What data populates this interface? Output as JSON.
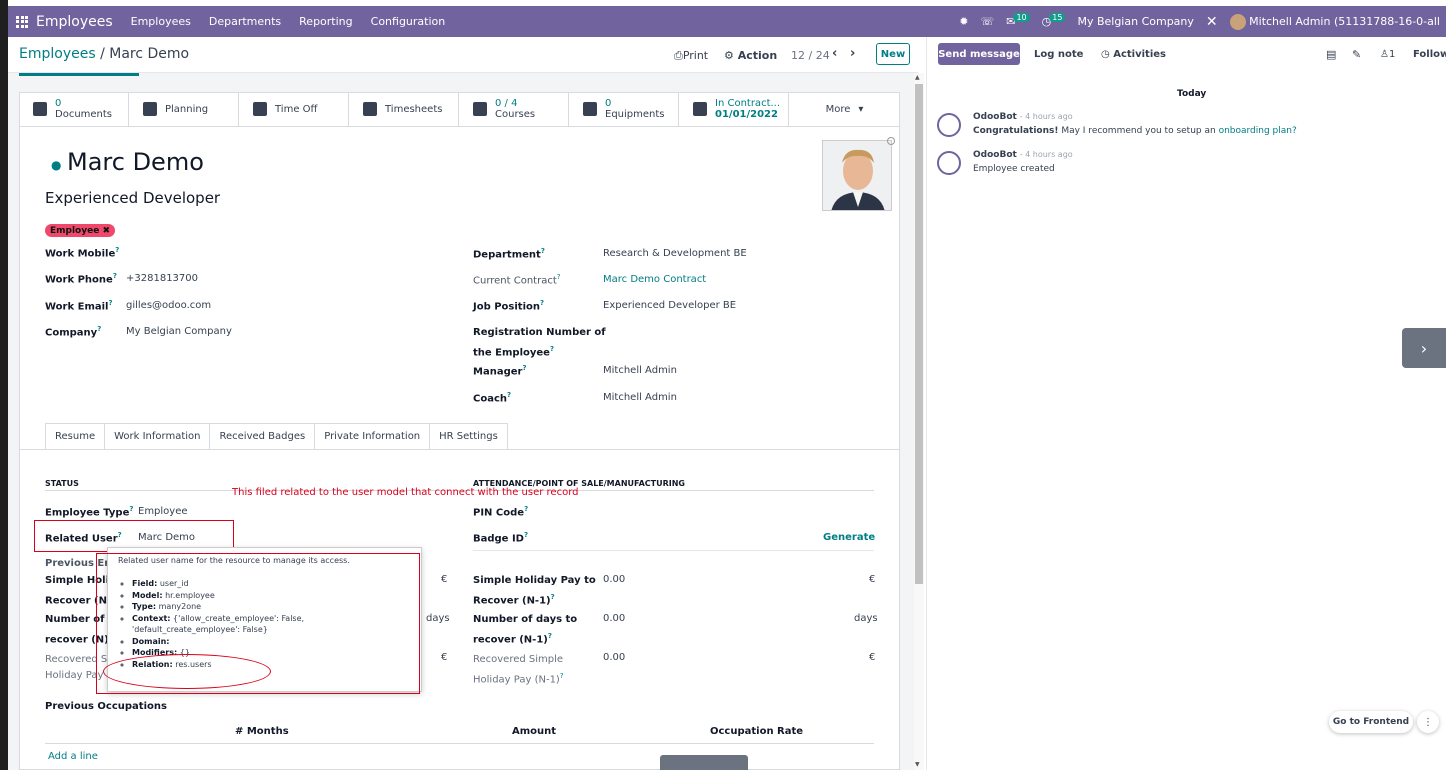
{
  "topbar": {
    "app_name": "Employees",
    "nav": [
      "Employees",
      "Departments",
      "Reporting",
      "Configuration"
    ],
    "messages_count": "10",
    "activities_count": "15",
    "company": "My Belgian Company",
    "user": "Mitchell Admin (51131788-16-0-all"
  },
  "control": {
    "breadcrumb_parent": "Employees",
    "breadcrumb_sep": "/",
    "breadcrumb_current": "Marc Demo",
    "print": "Print",
    "action": "Action",
    "pager": "12 / 24",
    "new": "New"
  },
  "smart_buttons": [
    {
      "num": "0",
      "label": "Documents"
    },
    {
      "num": "",
      "label": "Planning"
    },
    {
      "num": "",
      "label": "Time Off"
    },
    {
      "num": "",
      "label": "Timesheets"
    },
    {
      "num": "0 / 4",
      "label": "Courses"
    },
    {
      "num": "0",
      "label": "Equipments"
    },
    {
      "num": "In Contract...",
      "label": "01/01/2022"
    },
    {
      "num": "",
      "label": "More"
    }
  ],
  "employee": {
    "name": "Marc Demo",
    "job_title": "Experienced Developer",
    "tag": "Employee"
  },
  "left_fields": [
    {
      "label": "Work Mobile",
      "value": ""
    },
    {
      "label": "Work Phone",
      "value": "+3281813700"
    },
    {
      "label": "Work Email",
      "value": "gilles@odoo.com"
    },
    {
      "label": "Company",
      "value": "My Belgian Company"
    }
  ],
  "right_fields": [
    {
      "label": "Department",
      "value": "Research & Development BE"
    },
    {
      "label": "Current Contract",
      "value": "Marc Demo Contract"
    },
    {
      "label": "Job Position",
      "value": "Experienced Developer BE"
    },
    {
      "label": "Registration Number of",
      "label2": "the Employee",
      "value": ""
    },
    {
      "label": "Manager",
      "value": "Mitchell Admin"
    },
    {
      "label": "Coach",
      "value": "Mitchell Admin"
    }
  ],
  "tabs": [
    "Resume",
    "Work Information",
    "Received Badges",
    "Private Information",
    "HR Settings"
  ],
  "hr": {
    "status_heading": "STATUS",
    "attendance_heading": "ATTENDANCE/POINT OF SALE/MANUFACTURING",
    "annotation": "This filed related to the user model that connect with the user record",
    "employee_type_label": "Employee Type",
    "employee_type_value": "Employee",
    "related_user_label": "Related User",
    "related_user_value": "Marc Demo",
    "pin_label": "PIN Code",
    "badge_label": "Badge ID",
    "generate": "Generate",
    "prev_emp_partial": "Previous Emp",
    "simple_holiday_partial1": "Simple Holida",
    "simple_holiday_partial2": "Recover (N)",
    "days_partial1": "Number of da",
    "days_partial2": "recover (N)",
    "recovered_partial1": "Recovered Si",
    "recovered_partial2": "Holiday Pay (",
    "euro": "€",
    "days": "days",
    "r_simple_label1": "Simple Holiday Pay to",
    "r_simple_label2": "Recover (N-1)",
    "r_simple_value": "0.00",
    "r_days_label1": "Number of days to",
    "r_days_label2": "recover (N-1)",
    "r_days_value": "0.00",
    "r_recovered_label1": "Recovered Simple",
    "r_recovered_label2": "Holiday Pay (N-1)",
    "r_recovered_value": "0.00",
    "prev_occupations": "Previous Occupations",
    "col_months": "# Months",
    "col_amount": "Amount",
    "col_rate": "Occupation Rate",
    "add_line": "Add a line"
  },
  "tooltip": {
    "description": "Related user name for the resource to manage its access.",
    "field": "user_id",
    "model": "hr.employee",
    "type": "many2one",
    "context": "{'allow_create_employee': False, 'default_create_employee': False}",
    "domain": "",
    "modifiers": "{}",
    "relation": "res.users",
    "k_field": "Field:",
    "k_model": "Model:",
    "k_type": "Type:",
    "k_context": "Context:",
    "k_domain": "Domain:",
    "k_modifiers": "Modifiers:",
    "k_relation": "Relation:"
  },
  "chatter": {
    "send_message": "Send message",
    "log_note": "Log note",
    "activities": "Activities",
    "followers_count": "1",
    "follow": "Follow",
    "today": "Today",
    "messages": [
      {
        "author": "OdooBot",
        "time": "- 4 hours ago",
        "bold": "Congratulations!",
        "text": " May I recommend you to setup an ",
        "link": "onboarding plan?"
      },
      {
        "author": "OdooBot",
        "time": "- 4 hours ago",
        "bold": "",
        "text": "Employee created",
        "link": ""
      }
    ],
    "go_frontend": "Go to Frontend",
    "more": "⋮",
    "next": "›"
  },
  "colors": {
    "brand": "#71639e",
    "accent": "#017e84",
    "annotation_red": "#d9001b",
    "tag": "#f0486a"
  }
}
